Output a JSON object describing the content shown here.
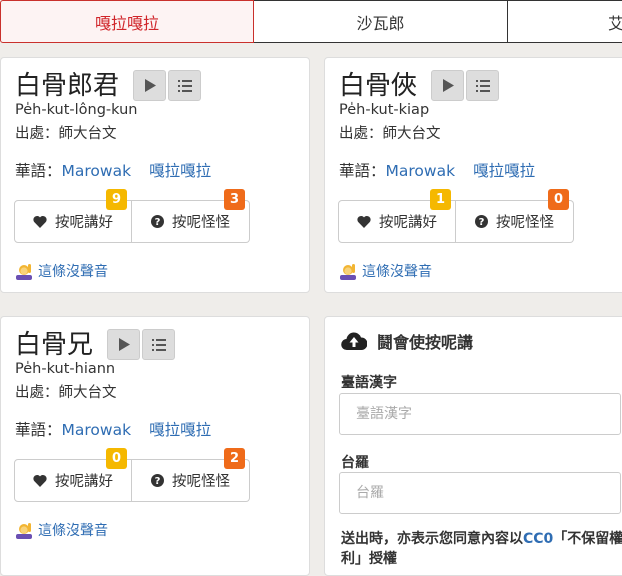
{
  "tabs": [
    {
      "label": "嘎拉嘎拉",
      "active": true
    },
    {
      "label": "沙瓦郎",
      "active": false
    },
    {
      "label": "艾",
      "active": false
    }
  ],
  "cards": [
    {
      "word": "白骨郎君",
      "romanization": "Pe̍h-kut-lông-kun",
      "source": "出處：師大台文",
      "huayu_label": "華語：",
      "huayu_links": [
        "Marowak",
        "嘎拉嘎拉"
      ],
      "like_label": "按呢講好",
      "like_count": "9",
      "odd_label": "按呢怪怪",
      "odd_count": "3",
      "report_label": "這條沒聲音"
    },
    {
      "word": "白骨俠",
      "romanization": "Pe̍h-kut-kiap",
      "source": "出處：師大台文",
      "huayu_label": "華語：",
      "huayu_links": [
        "Marowak",
        "嘎拉嘎拉"
      ],
      "like_label": "按呢講好",
      "like_count": "1",
      "odd_label": "按呢怪怪",
      "odd_count": "0",
      "report_label": "這條沒聲音"
    },
    {
      "word": "白骨兄",
      "romanization": "Pe̍h-kut-hiann",
      "source": "出處：師大台文",
      "huayu_label": "華語：",
      "huayu_links": [
        "Marowak",
        "嘎拉嘎拉"
      ],
      "like_label": "按呢講好",
      "like_count": "0",
      "odd_label": "按呢怪怪",
      "odd_count": "2",
      "report_label": "這條沒聲音"
    }
  ],
  "form": {
    "title": "鬪會使按呢講",
    "hanzi_label": "臺語漢字",
    "hanzi_placeholder": "臺語漢字",
    "roman_label": "台羅",
    "roman_placeholder": "台羅",
    "note_prefix": "送出時，亦表示您同意內容以",
    "note_link": "CC0",
    "note_suffix": "「不保留權利」授權"
  },
  "colors": {
    "accent_red": "#d0252a",
    "link_blue": "#2f6db3",
    "badge_yellow": "#f5b800",
    "badge_orange": "#ef6b1a"
  }
}
